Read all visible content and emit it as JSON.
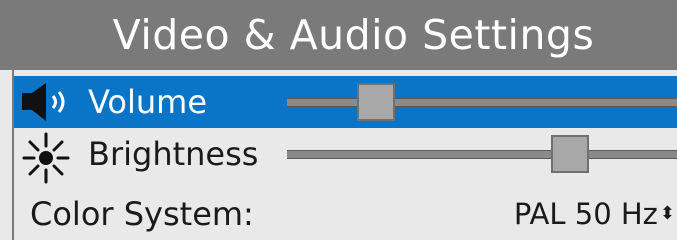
{
  "title": "Video & Audio Settings",
  "rows": {
    "volume": {
      "label": "Volume",
      "icon": "speaker-icon",
      "value_fraction": 0.2,
      "selected": true
    },
    "brightness": {
      "label": "Brightness",
      "icon": "sun-icon",
      "value_fraction": 0.75,
      "selected": false
    },
    "color_system": {
      "label": "Color System:",
      "value": "PAL 50 Hz",
      "arrow_glyph": "⬍"
    }
  },
  "colors": {
    "title_bar": "#7a7a7a",
    "selection": "#0a74c6",
    "background": "#e9e9e9"
  }
}
